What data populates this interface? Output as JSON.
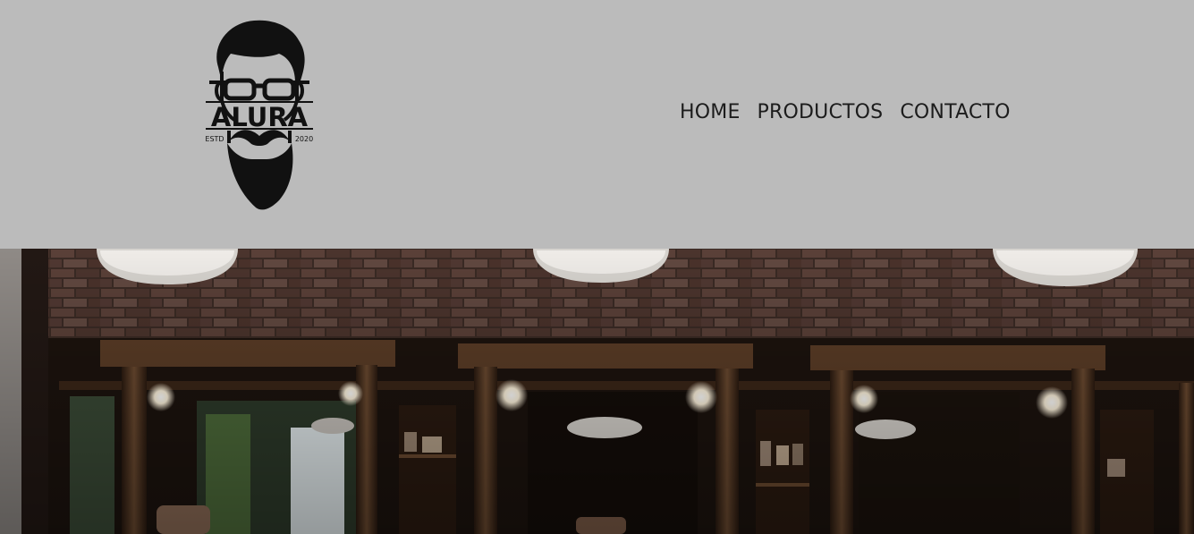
{
  "header": {
    "logo": {
      "name": "alura-logo",
      "text": "ALURA",
      "left_text": "ESTD",
      "right_text": "2020"
    },
    "nav": [
      {
        "label": "HOME"
      },
      {
        "label": "PRODUCTOS"
      },
      {
        "label": "CONTACTO"
      }
    ]
  },
  "hero": {
    "image": "barbershop-interior-image"
  },
  "colors": {
    "header_bg": "#bbbbbb",
    "nav_text": "#1c1c1c",
    "hero_dark": "#1a120d"
  }
}
